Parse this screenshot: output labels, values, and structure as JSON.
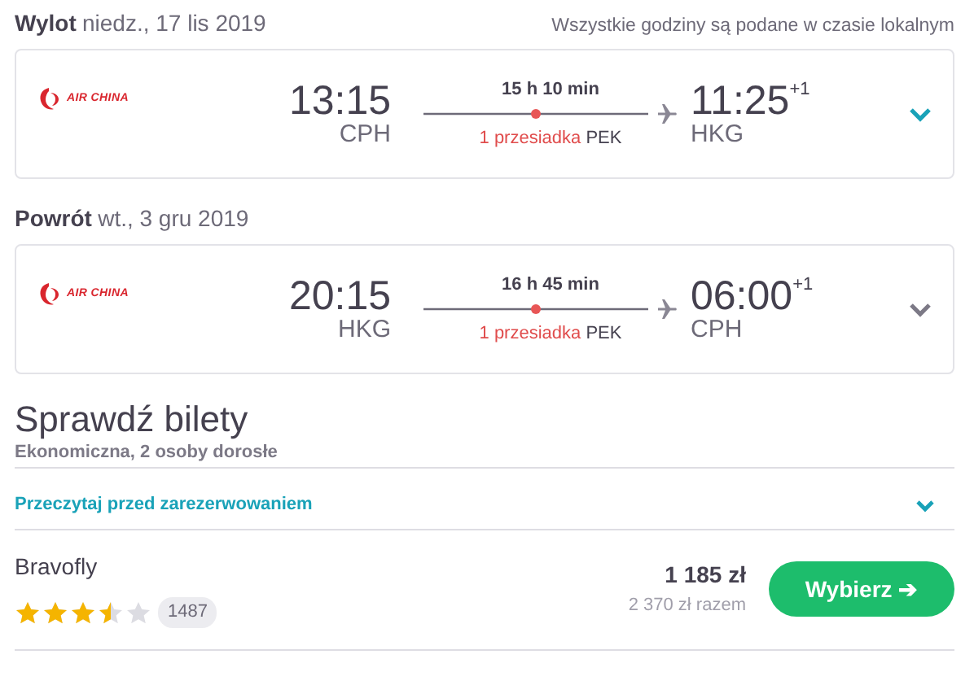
{
  "legs": [
    {
      "label": "Wylot",
      "date": "niedz., 17 lis 2019",
      "note": "Wszystkie godziny są podane w czasie lokalnym",
      "airline": "AIR CHINA",
      "departure_time": "13:15",
      "departure_airport": "CPH",
      "duration": "15 h 10 min",
      "arrival_time": "11:25",
      "day_offset": "+1",
      "arrival_airport": "HKG",
      "stops": "1 przesiadka",
      "stop_airport": "PEK",
      "highlighted": true
    },
    {
      "label": "Powrót",
      "date": "wt., 3 gru 2019",
      "airline": "AIR CHINA",
      "departure_time": "20:15",
      "departure_airport": "HKG",
      "duration": "16 h 45 min",
      "arrival_time": "06:00",
      "day_offset": "+1",
      "arrival_airport": "CPH",
      "stops": "1 przesiadka",
      "stop_airport": "PEK",
      "highlighted": false
    }
  ],
  "tickets": {
    "title": "Sprawdź bilety",
    "subtitle": "Ekonomiczna, 2 osoby dorosłe",
    "info_link": "Przeczytaj przed zarezerwowaniem",
    "offer": {
      "provider": "Bravofly",
      "stars": 3.5,
      "reviews": "1487",
      "price": "1 185 zł",
      "total": "2 370 zł razem",
      "button": "Wybierz ➔"
    }
  }
}
